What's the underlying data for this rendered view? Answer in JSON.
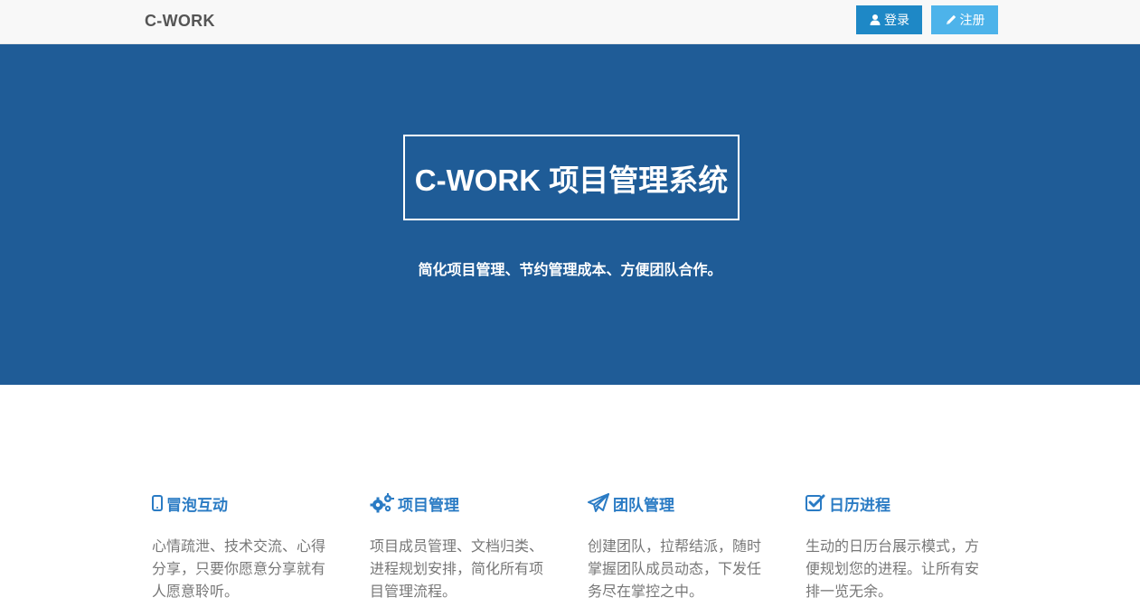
{
  "navbar": {
    "brand": "C-WORK",
    "login_label": "登录",
    "register_label": "注册",
    "login_icon": "user-icon",
    "register_icon": "pencil-icon"
  },
  "hero": {
    "title": "C-WORK 项目管理系统",
    "subtitle": "简化项目管理、节约管理成本、方便团队合作。"
  },
  "features": [
    {
      "icon": "mobile-icon",
      "title": "冒泡互动",
      "desc": "心情疏泄、技术交流、心得分享，只要你愿意分享就有人愿意聆听。"
    },
    {
      "icon": "gears-icon",
      "title": "项目管理",
      "desc": "项目成员管理、文档归类、进程规划安排，简化所有项目管理流程。"
    },
    {
      "icon": "paper-plane-icon",
      "title": "团队管理",
      "desc": "创建团队，拉帮结派，随时掌握团队成员动态，下发任务尽在掌控之中。"
    },
    {
      "icon": "check-square-icon",
      "title": "日历进程",
      "desc": "生动的日历台展示模式，方便规划您的进程。让所有安排一览无余。"
    }
  ],
  "colors": {
    "hero_bg": "#1f5c97",
    "login_btn": "#1e88c6",
    "register_btn": "#4db3ea",
    "feature_title": "#2a7bc4"
  }
}
